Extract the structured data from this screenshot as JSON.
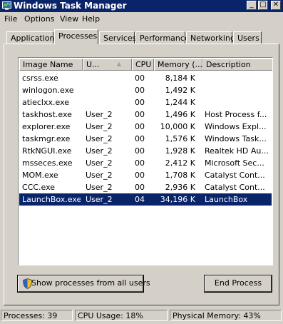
{
  "window": {
    "title": "Windows Task Manager",
    "minimize_glyph": "_",
    "maximize_glyph": "□",
    "close_glyph": "✕"
  },
  "menu": [
    "File",
    "Options",
    "View",
    "Help"
  ],
  "tabs": [
    {
      "label": "Applications",
      "active": false
    },
    {
      "label": "Processes",
      "active": true
    },
    {
      "label": "Services",
      "active": false
    },
    {
      "label": "Performance",
      "active": false
    },
    {
      "label": "Networking",
      "active": false
    },
    {
      "label": "Users",
      "active": false
    }
  ],
  "columns": {
    "image_name": "Image Name",
    "user": "U...",
    "sort_glyph": "▲",
    "cpu": "CPU",
    "memory": "Memory (...",
    "description": "Description"
  },
  "processes": [
    {
      "name": "csrss.exe",
      "user": "",
      "cpu": "00",
      "memory": "8,184 K",
      "description": ""
    },
    {
      "name": "winlogon.exe",
      "user": "",
      "cpu": "00",
      "memory": "1,492 K",
      "description": ""
    },
    {
      "name": "atieclxx.exe",
      "user": "",
      "cpu": "00",
      "memory": "1,244 K",
      "description": ""
    },
    {
      "name": "taskhost.exe",
      "user": "User_2",
      "cpu": "00",
      "memory": "1,496 K",
      "description": "Host Process f..."
    },
    {
      "name": "explorer.exe",
      "user": "User_2",
      "cpu": "00",
      "memory": "10,000 K",
      "description": "Windows Expl..."
    },
    {
      "name": "taskmgr.exe",
      "user": "User_2",
      "cpu": "00",
      "memory": "1,576 K",
      "description": "Windows Task..."
    },
    {
      "name": "RtkNGUI.exe",
      "user": "User_2",
      "cpu": "00",
      "memory": "1,928 K",
      "description": "Realtek HD Au..."
    },
    {
      "name": "msseces.exe",
      "user": "User_2",
      "cpu": "00",
      "memory": "2,412 K",
      "description": "Microsoft Sec..."
    },
    {
      "name": "MOM.exe",
      "user": "User_2",
      "cpu": "00",
      "memory": "1,708 K",
      "description": "Catalyst Cont..."
    },
    {
      "name": "CCC.exe",
      "user": "User_2",
      "cpu": "00",
      "memory": "2,936 K",
      "description": "Catalyst Cont..."
    },
    {
      "name": "LaunchBox.exe",
      "user": "User_2",
      "cpu": "04",
      "memory": "34,196 K",
      "description": "LaunchBox",
      "selected": true
    }
  ],
  "buttons": {
    "show_all": "Show processes from all users",
    "end_process": "End Process"
  },
  "status": {
    "processes": "Processes: 39",
    "cpu_usage": "CPU Usage: 18%",
    "physical_memory": "Physical Memory: 43%"
  },
  "colors": {
    "titlebar": "#0a246a",
    "selection": "#0a246a",
    "face": "#d4d0c8"
  }
}
